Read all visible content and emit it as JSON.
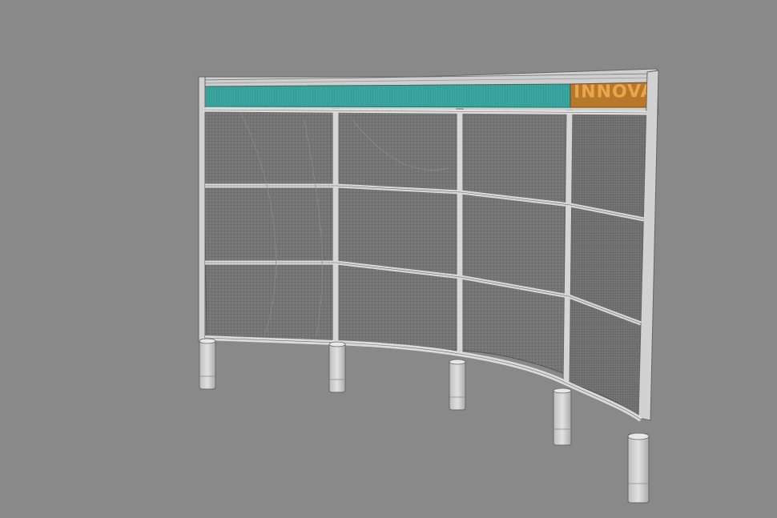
{
  "scene": {
    "type": "3d-viewport-wireframe-render",
    "colors": {
      "background": "#898989",
      "mesh": "#6e6e6e",
      "frame": "#d4d4d4",
      "frame_edge": "#5a5a5a",
      "header_band": "#3aa6a0",
      "header_logo_panel": "#b8782c",
      "header_logo_text": "#e7a64a",
      "post": "#c8c8c8"
    },
    "panel_columns": 4,
    "panel_rows": 3,
    "support_posts": 5
  },
  "header": {
    "logo_text": "INNOVA"
  }
}
